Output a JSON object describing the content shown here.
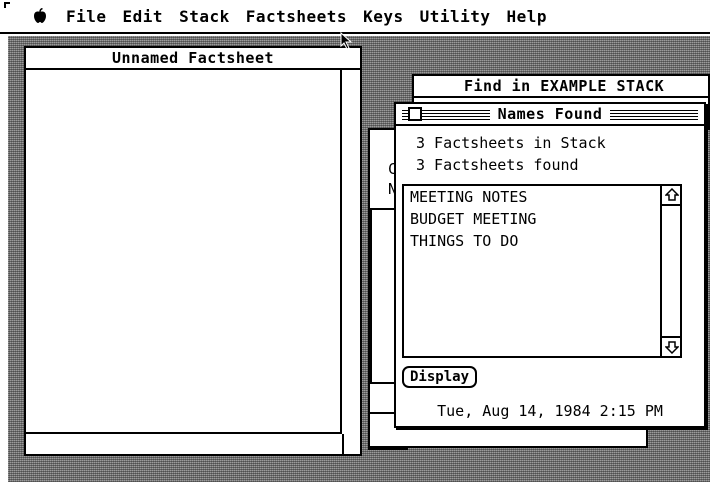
{
  "menubar": {
    "apple_icon": "apple-icon",
    "items": [
      "File",
      "Edit",
      "Stack",
      "Factsheets",
      "Keys",
      "Utility",
      "Help"
    ]
  },
  "unnamed_window": {
    "title": "Unnamed Factsheet"
  },
  "find_window": {
    "title": "Find in EXAMPLE STACK",
    "partial_text_1": "C",
    "partial_text_2": "N"
  },
  "names_window": {
    "title": "Names Found",
    "stack_count_text": "3 Factsheets in Stack",
    "found_count_text": "3 Factsheets found",
    "results": [
      "MEETING NOTES",
      "BUDGET MEETING",
      "THINGS TO DO"
    ],
    "display_button": "Display",
    "datetime": "Tue, Aug 14, 1984 2:15 PM"
  }
}
